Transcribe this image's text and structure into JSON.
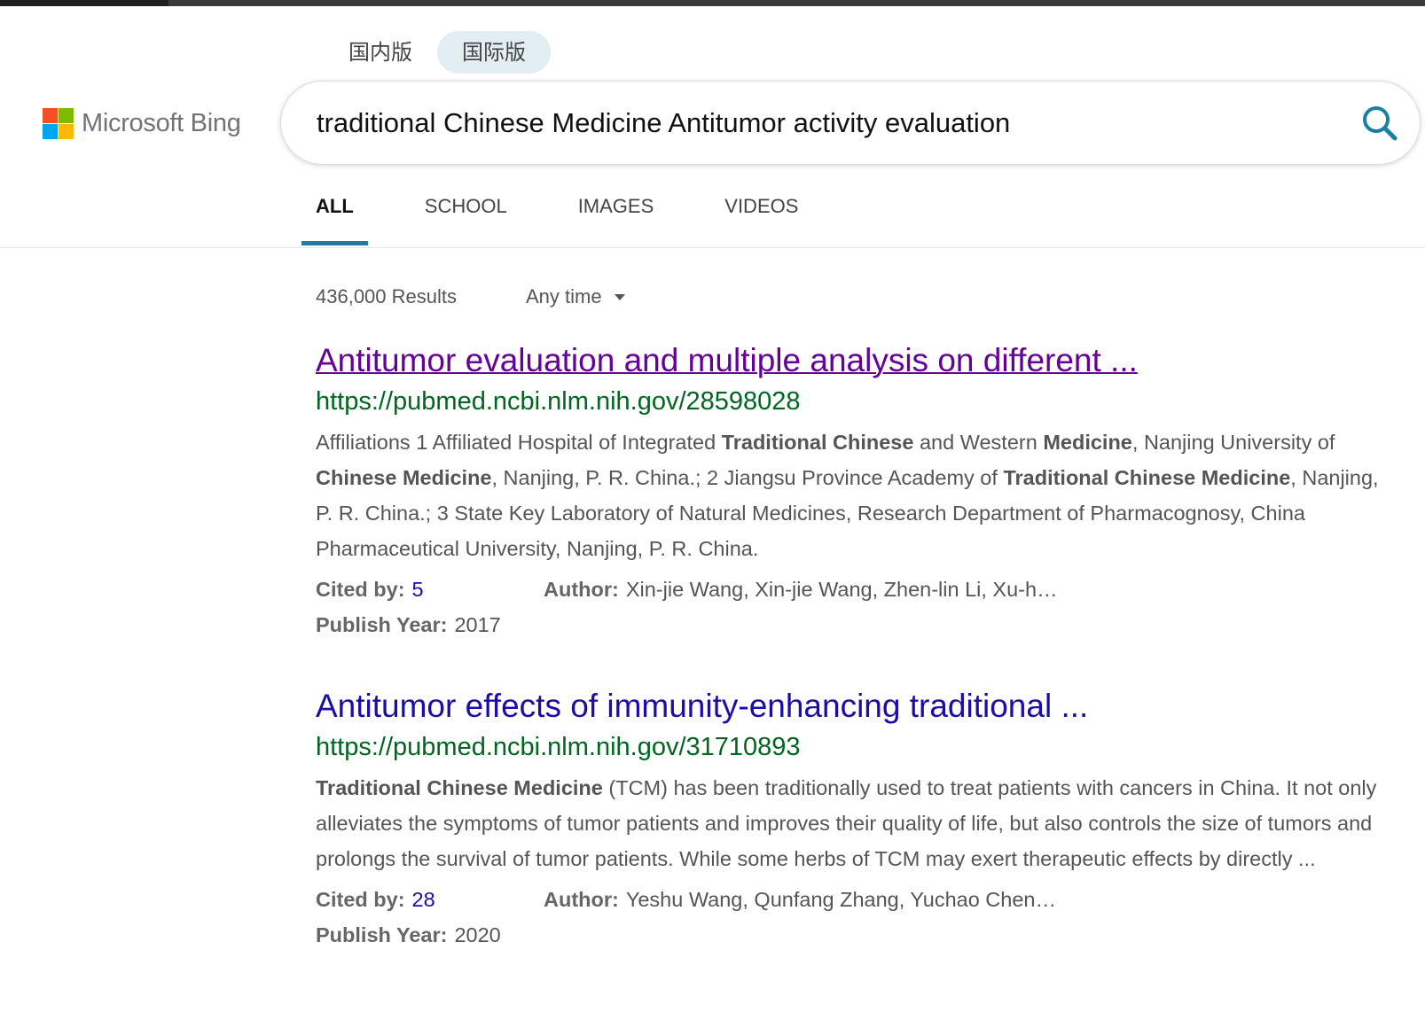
{
  "brand": {
    "name": "Microsoft Bing",
    "logo_colors": [
      "#f25022",
      "#7fba00",
      "#00a4ef",
      "#ffb900"
    ]
  },
  "region_tabs": [
    {
      "label": "国内版",
      "active": false
    },
    {
      "label": "国际版",
      "active": true
    }
  ],
  "search": {
    "query": "traditional Chinese Medicine Antitumor activity evaluation",
    "icon": "search-icon",
    "icon_color": "#1a7fa3"
  },
  "nav_tabs": [
    {
      "label": "ALL",
      "active": true
    },
    {
      "label": "SCHOOL",
      "active": false
    },
    {
      "label": "IMAGES",
      "active": false
    },
    {
      "label": "VIDEOS",
      "active": false
    }
  ],
  "results_meta": {
    "count": "436,000 Results",
    "time_filter": "Any time"
  },
  "results": [
    {
      "title": "Antitumor evaluation and multiple analysis on different ...",
      "url": "https://pubmed.ncbi.nlm.nih.gov/28598028",
      "visited": true,
      "snippet": [
        {
          "t": "Affiliations 1 Affiliated Hospital of Integrated ",
          "b": false
        },
        {
          "t": "Traditional Chinese",
          "b": true
        },
        {
          "t": " and Western ",
          "b": false
        },
        {
          "t": "Medicine",
          "b": true
        },
        {
          "t": ", Nanjing University of ",
          "b": false
        },
        {
          "t": "Chinese Medicine",
          "b": true
        },
        {
          "t": ", Nanjing, P. R. China.; 2 Jiangsu Province Academy of ",
          "b": false
        },
        {
          "t": "Traditional Chinese Medicine",
          "b": true
        },
        {
          "t": ", Nanjing, P. R. China.; 3 State Key Laboratory of Natural Medicines, Research Department of Pharmacognosy, China Pharmaceutical University, Nanjing, P. R. China.",
          "b": false
        }
      ],
      "cited_label": "Cited by:",
      "cited_value": "5",
      "author_label": "Author:",
      "author_value": "Xin-jie Wang, Xin-jie Wang, Zhen-lin Li, Xu-h…",
      "year_label": "Publish Year:",
      "year_value": "2017"
    },
    {
      "title": "Antitumor effects of immunity-enhancing traditional ...",
      "url": "https://pubmed.ncbi.nlm.nih.gov/31710893",
      "visited": false,
      "snippet": [
        {
          "t": "Traditional Chinese Medicine",
          "b": true
        },
        {
          "t": " (TCM) has been traditionally used to treat patients with cancers in China. It not only alleviates the symptoms of tumor patients and improves their quality of life, but also controls the size of tumors and prolongs the survival of tumor patients. While some herbs of TCM may exert therapeutic effects by directly ...",
          "b": false
        }
      ],
      "cited_label": "Cited by:",
      "cited_value": "28",
      "author_label": "Author:",
      "author_value": "Yeshu Wang, Qunfang Zhang, Yuchao Chen…",
      "year_label": "Publish Year:",
      "year_value": "2020"
    }
  ]
}
